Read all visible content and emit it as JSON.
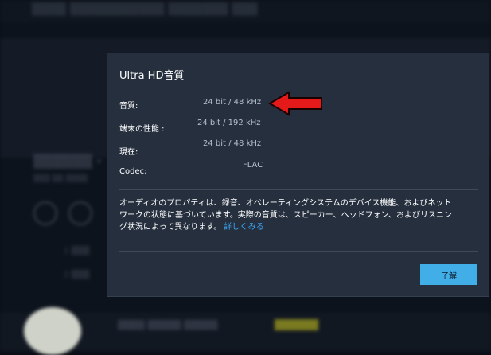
{
  "dialog": {
    "title": "Ultra HD音質",
    "specs": [
      {
        "label": "音質:",
        "value": "24 bit / 48 kHz"
      },
      {
        "label": "端末の性能 :",
        "value": "24 bit / 192 kHz"
      },
      {
        "label": "現在:",
        "value": "24 bit / 48 kHz"
      },
      {
        "label": "Codec:",
        "value": "FLAC"
      }
    ],
    "description_lines": [
      "オーディオのプロパティは、録音、オペレーティングシステムのデバイス機能、およびネット",
      "ワークの状態に基づいています。実際の音質は、スピーカー、ヘッドフォン、およびリスニン",
      "グ状況によって異なります。"
    ],
    "learn_more_link": "詳しくみる",
    "ok_button": "了解"
  },
  "colors": {
    "dialog_bg": "#252f3e",
    "accent_button": "#41aee8",
    "link": "#3da6f2",
    "annotation_arrow": "#e41a1a"
  }
}
